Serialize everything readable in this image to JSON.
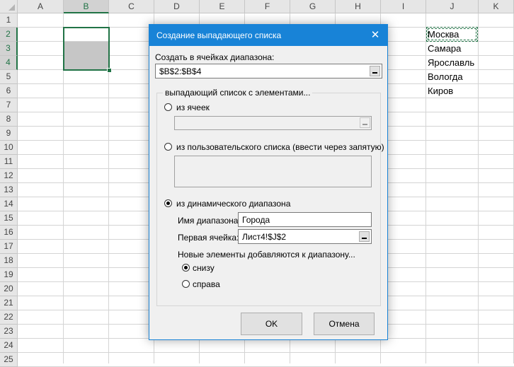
{
  "sheet": {
    "corner": "",
    "columns": [
      {
        "label": "A",
        "selected": false
      },
      {
        "label": "B",
        "selected": true
      },
      {
        "label": "C",
        "selected": false
      },
      {
        "label": "D",
        "selected": false
      },
      {
        "label": "E",
        "selected": false
      },
      {
        "label": "F",
        "selected": false
      },
      {
        "label": "G",
        "selected": false
      },
      {
        "label": "H",
        "selected": false
      },
      {
        "label": "I",
        "selected": false
      },
      {
        "label": "J",
        "selected": false
      },
      {
        "label": "K",
        "selected": false
      }
    ],
    "rows": [
      {
        "label": "1",
        "selected": false
      },
      {
        "label": "2",
        "selected": true
      },
      {
        "label": "3",
        "selected": true
      },
      {
        "label": "4",
        "selected": true
      },
      {
        "label": "5",
        "selected": false
      },
      {
        "label": "6",
        "selected": false
      },
      {
        "label": "7",
        "selected": false
      },
      {
        "label": "8",
        "selected": false
      },
      {
        "label": "9",
        "selected": false
      },
      {
        "label": "10",
        "selected": false
      },
      {
        "label": "11",
        "selected": false
      },
      {
        "label": "12",
        "selected": false
      },
      {
        "label": "13",
        "selected": false
      },
      {
        "label": "14",
        "selected": false
      },
      {
        "label": "15",
        "selected": false
      },
      {
        "label": "16",
        "selected": false
      },
      {
        "label": "17",
        "selected": false
      },
      {
        "label": "18",
        "selected": false
      },
      {
        "label": "19",
        "selected": false
      },
      {
        "label": "20",
        "selected": false
      },
      {
        "label": "21",
        "selected": false
      },
      {
        "label": "22",
        "selected": false
      },
      {
        "label": "23",
        "selected": false
      },
      {
        "label": "24",
        "selected": false
      },
      {
        "label": "25",
        "selected": false
      }
    ],
    "cities": [
      "Москва",
      "Самара",
      "Ярославль",
      "Вологда",
      "Киров"
    ],
    "accent": "#217346"
  },
  "dialog": {
    "title": "Создание выпадающего списка",
    "accent": "#1883d7",
    "range_label": "Создать в ячейках диапазона:",
    "range_value": "$B$2:$B$4",
    "group_label": "выпадающий список с элементами...",
    "opt_cells_label": "из ячеек",
    "opt_cells_checked": false,
    "cells_value": "",
    "opt_custom_label": "из пользовательского списка (ввести через запятую)",
    "opt_custom_checked": false,
    "custom_value": "",
    "opt_dynamic_label": "из динамического диапазона",
    "opt_dynamic_checked": true,
    "range_name_label": "Имя диапазона:",
    "range_name_value": "Города",
    "first_cell_label": "Первая ячейка:",
    "first_cell_value": "Лист4!$J$2",
    "new_items_label": "Новые элементы добавляются к диапазону...",
    "opt_below_label": "снизу",
    "opt_below_checked": true,
    "opt_right_label": "справа",
    "opt_right_checked": false,
    "ok_label": "OK",
    "cancel_label": "Отмена"
  }
}
